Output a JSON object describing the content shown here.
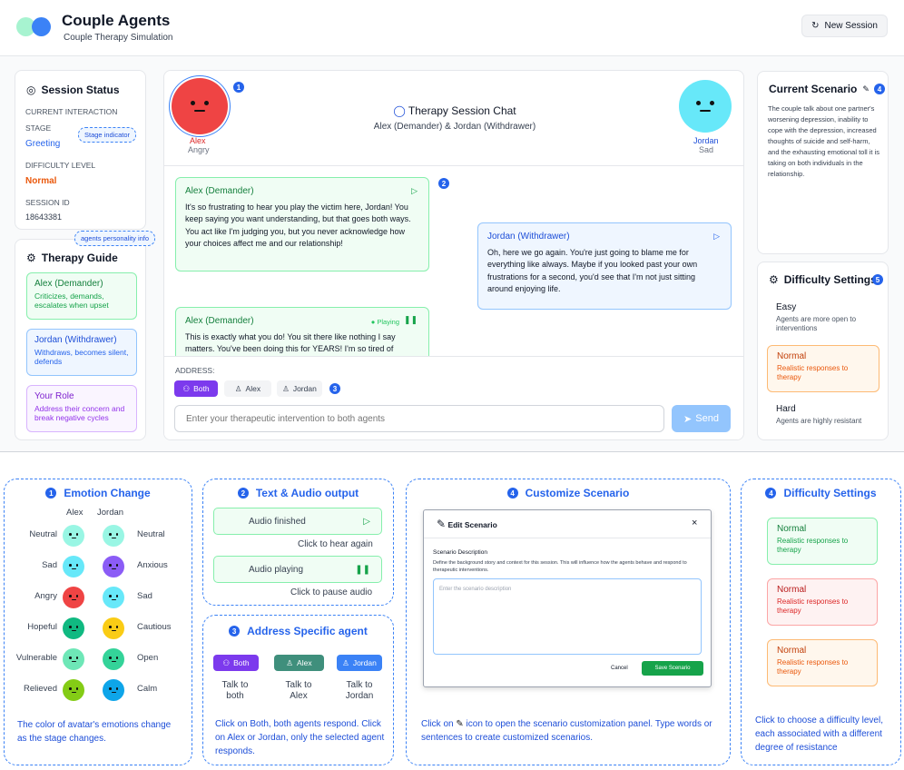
{
  "app": {
    "title": "Couple Agents",
    "subtitle": "Couple Therapy Simulation",
    "new_session": "New Session"
  },
  "status": {
    "title": "Session Status",
    "current_interaction": "CURRENT INTERACTION",
    "stage_label": "STAGE",
    "stage": "Greeting",
    "stage_tip": "Stage indicator",
    "difficulty_label": "DIFFICULTY LEVEL",
    "difficulty": "Normal",
    "session_label": "SESSION ID",
    "session_id": "18643381"
  },
  "guide": {
    "tip": "agents personality info",
    "title": "Therapy Guide",
    "items": [
      {
        "title": "Alex (Demander)",
        "desc": "Criticizes, demands, escalates when upset"
      },
      {
        "title": "Jordan (Withdrawer)",
        "desc": "Withdraws, becomes silent, defends"
      },
      {
        "title": "Your Role",
        "desc": "Address their concern and break negative cycles"
      }
    ]
  },
  "chat": {
    "title": "Therapy Session Chat",
    "subtitle": "Alex (Demander) & Jordan (Withdrawer)",
    "alex_name": "Alex",
    "alex_emotion": "Angry",
    "jordan_name": "Jordan",
    "jordan_emotion": "Sad",
    "messages": [
      {
        "who": "Alex (Demander)",
        "text": "It's so frustrating to hear you play the victim here, Jordan! You keep saying  you want understanding, but that goes both ways. You act like I'm judging you, but you never acknowledge how your choices affect me and our relationship!"
      },
      {
        "who": "Jordan (Withdrawer)",
        "text": "Oh, here we go again. You're just going to blame me for everything like always. Maybe if you looked past your own frustrations for a second, you'd see that I'm not just sitting around enjoying life."
      },
      {
        "who": "Alex (Demander)",
        "status": "Playing",
        "text": "This is exactly what you do! You sit there like nothing I say matters. You've been doing this for YEARS! I'm so tired of"
      }
    ],
    "address_label": "ADDRESS:",
    "addr_both": "Both",
    "addr_alex": "Alex",
    "addr_jordan": "Jordan",
    "placeholder": "Enter your therapeutic intervention to both agents",
    "send": "Send"
  },
  "scenario": {
    "title": "Current Scenario",
    "text": "The couple talk about one partner's worsening depression, inability to cope with the depression, increased thoughts of suicide and self-harm, and the exhausting emotional toll it is taking on both individuals in the relationship."
  },
  "difficulty": {
    "title": "Difficulty Settings",
    "options": [
      {
        "t": "Easy",
        "d": "Agents are more open to interventions"
      },
      {
        "t": "Normal",
        "d": "Realistic responses to therapy"
      },
      {
        "t": "Hard",
        "d": "Agents are highly resistant"
      }
    ]
  },
  "badges": {
    "b1": "1",
    "b2": "2",
    "b3": "3",
    "b4": "4",
    "b5": "5"
  },
  "p1": {
    "title": "Emotion Change",
    "col_alex": "Alex",
    "col_jordan": "Jordan",
    "rows": [
      {
        "l": "Neutral",
        "r": "Neutral"
      },
      {
        "l": "Sad",
        "r": "Anxious"
      },
      {
        "l": "Angry",
        "r": "Sad"
      },
      {
        "l": "Hopeful",
        "r": "Cautious"
      },
      {
        "l": "Vulnerable",
        "r": "Open"
      },
      {
        "l": "Relieved",
        "r": "Calm"
      }
    ],
    "note": "The color of avatar's emotions change as the stage changes."
  },
  "p2": {
    "title": "Text & Audio output",
    "finished": "Audio finished",
    "hear": "Click to hear again",
    "playing": "Audio playing",
    "pause": "Click to pause audio"
  },
  "p3": {
    "title": "Address Specific agent",
    "both": "Both",
    "alex": "Alex",
    "jordan": "Jordan",
    "c1": "Talk to both",
    "c2": "Talk to Alex",
    "c3": "Talk to Jordan",
    "note": "Click on Both, both agents respond. Click on Alex or Jordan, only the selected agent responds."
  },
  "p4": {
    "title": "Customize Scenario",
    "modal_title": "Edit Scenario",
    "close": "×",
    "desc_label": "Scenario Description",
    "desc_help": "Define the background story and context for this session. This will influence how the agents behave and respond to therapeutic interventions.",
    "placeholder": "Enter the scenario description",
    "cancel": "Cancel",
    "save": "Save Scenario",
    "note_a": "Click on",
    "note_b": "icon to open the scenario customization panel. Type words or sentences to create customized scenarios."
  },
  "p5": {
    "title": "Difficulty Settings",
    "badge": "4",
    "opts": [
      {
        "t": "Normal",
        "d": "Realistic responses to therapy"
      },
      {
        "t": "Normal",
        "d": "Realistic responses to therapy"
      },
      {
        "t": "Normal",
        "d": "Realistic responses to therapy"
      }
    ],
    "note": "Click to choose a difficulty level, each associated with a different degree of resistance"
  },
  "colors": {
    "accent": "#2563eb",
    "alex": "#ef4444",
    "jordan": "#67e8f9"
  }
}
